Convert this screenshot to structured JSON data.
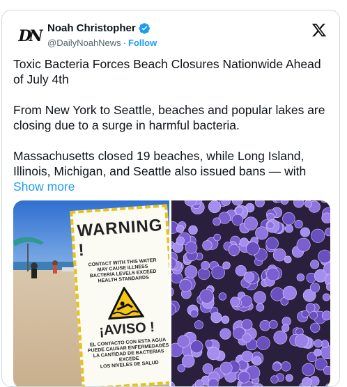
{
  "author": {
    "name": "Noah Christopher",
    "handle": "@DailyNoahNews",
    "separator": "·",
    "follow_label": "Follow",
    "avatar_text": "DN"
  },
  "tweet": {
    "paragraphs": [
      "Toxic Bacteria Forces Beach Closures Nationwide Ahead of July 4th",
      "From New York to Seattle, beaches and popular lakes are closing due to a surge in harmful bacteria."
    ],
    "last_paragraph": "Massachusetts closed 19 beaches, while Long Island, Illinois, Michigan, and Seattle also issued bans — with",
    "show_more_label": "Show more"
  },
  "sign": {
    "title": "WARNING !",
    "lines": [
      "CONTACT WITH THIS WATER",
      "MAY CAUSE ILLNESS",
      "BACTERIA LEVELS EXCEED",
      "HEALTH STANDARDS"
    ],
    "aviso": "¡AVISO !",
    "lines_es": [
      "EL CONTACTO CON ESTA AGUA",
      "PUEDE CAUSAR ENFERMEDADES",
      "LA CANTIDAD DE BACTERIAS EXCEDE",
      "LOS NIVELES DE SALUD"
    ]
  },
  "icons": {
    "verified": "verified-badge-icon",
    "x_logo": "x-logo-icon"
  },
  "colors": {
    "accent": "#1d9bf0",
    "text": "#0f1419",
    "secondary": "#536471",
    "sign_border": "#e8c11a",
    "bacteria": "#8a6fd6"
  }
}
